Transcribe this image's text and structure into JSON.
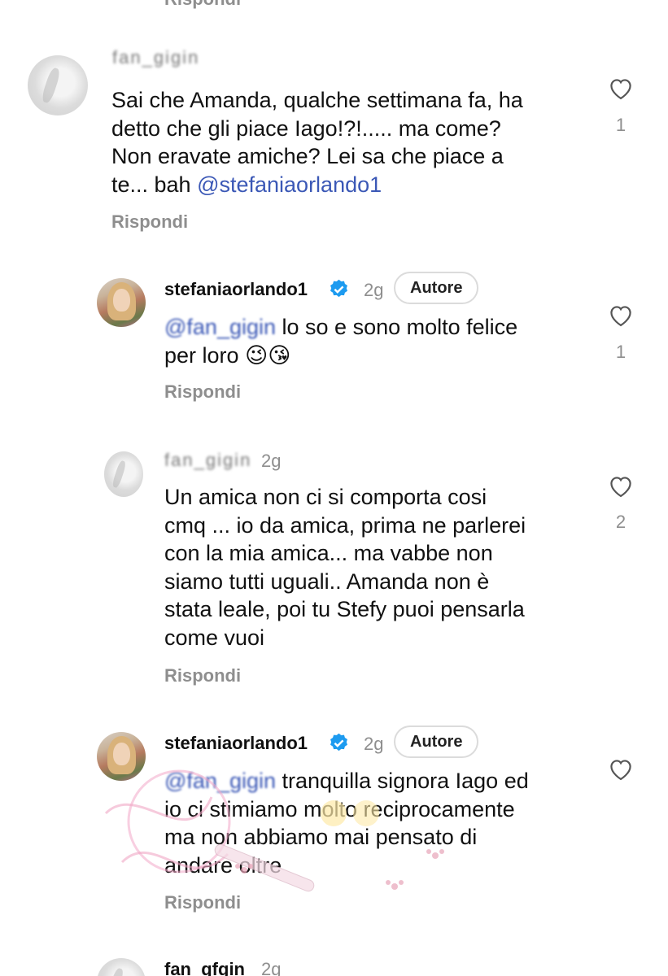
{
  "top_cut": "Rispondi",
  "reply_label": "Rispondi",
  "comments": [
    {
      "username_obscured": "fan_gigin",
      "text": "Sai che Amanda, qualche settimana fa, ha\ndetto che gli piace Iago!?!..... ma come?\nNon eravate amiche? Lei sa che piace a\nte... bah ",
      "mention": "@stefaniaorlando1",
      "likes": "1"
    },
    {
      "username": "stefaniaorlando1",
      "time": "2g",
      "badge": "Autore",
      "mention": "@fan_gigin",
      "text": " lo so e sono molto felice\nper loro ",
      "emoji": "😉😘",
      "likes": "1"
    },
    {
      "username_obscured": "fan_gigin",
      "time": "2g",
      "text": "Un amica non ci si comporta cosi\ncmq ... io da amica, prima ne parlerei\ncon la mia amica... ma vabbe non\nsiamo tutti uguali.. Amanda non è\nstata leale, poi tu Stefy puoi  pensarla\ncome vuoi",
      "likes": "2"
    },
    {
      "username": "stefaniaorlando1",
      "time": "2g",
      "badge": "Autore",
      "mention": "@fan_gigin",
      "text": " tranquilla signora Iago ed\nio ci stimiamo molto reciprocamente\nma non abbiamo mai pensato di\nandare oltre"
    },
    {
      "username_partial": "fan_gfgin",
      "time": "2g"
    }
  ],
  "colors": {
    "mention": "#3b58b6",
    "muted": "#8e8e8e",
    "verified": "#1d9bf0"
  }
}
